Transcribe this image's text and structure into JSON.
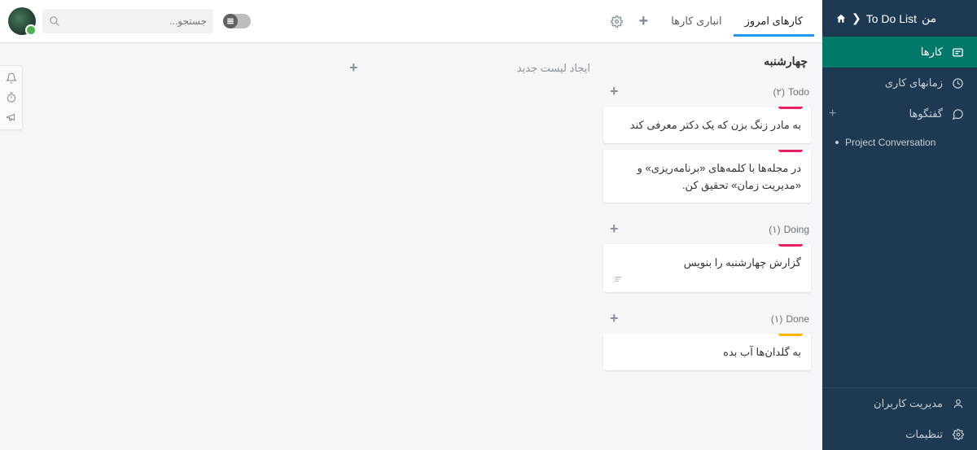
{
  "breadcrumb": {
    "project": "To Do List",
    "suffix": "من"
  },
  "sidebar": {
    "items": [
      "کارها",
      "زمانهای کاری",
      "گفتگوها"
    ],
    "sub": "Project Conversation",
    "bottom": [
      "مدیریت کاربران",
      "تنظیمات"
    ]
  },
  "search": {
    "placeholder": "جستجو..."
  },
  "tabs": [
    "کارهای امروز",
    "انباری کارها"
  ],
  "board": {
    "column_title": "چهارشنبه",
    "new_list": "ایجاد لیست جدید",
    "sections": [
      {
        "name": "Todo",
        "count": "(۲)",
        "cards": [
          {
            "text": "به مادر زنگ بزن که یک دکتر معرفی کند",
            "color": "pink"
          },
          {
            "text": "در مجله‌ها با کلمه‌های «برنامه‌ریزی» و «مدیریت زمان» تحقیق کن.",
            "color": "pink"
          }
        ]
      },
      {
        "name": "Doing",
        "count": "(۱)",
        "cards": [
          {
            "text": "گزارش چهارشنبه را بنویس",
            "color": "pink",
            "has_desc": true
          }
        ]
      },
      {
        "name": "Done",
        "count": "(۱)",
        "cards": [
          {
            "text": "به گلدان‌ها آب بده",
            "color": "yellow"
          }
        ]
      }
    ]
  }
}
